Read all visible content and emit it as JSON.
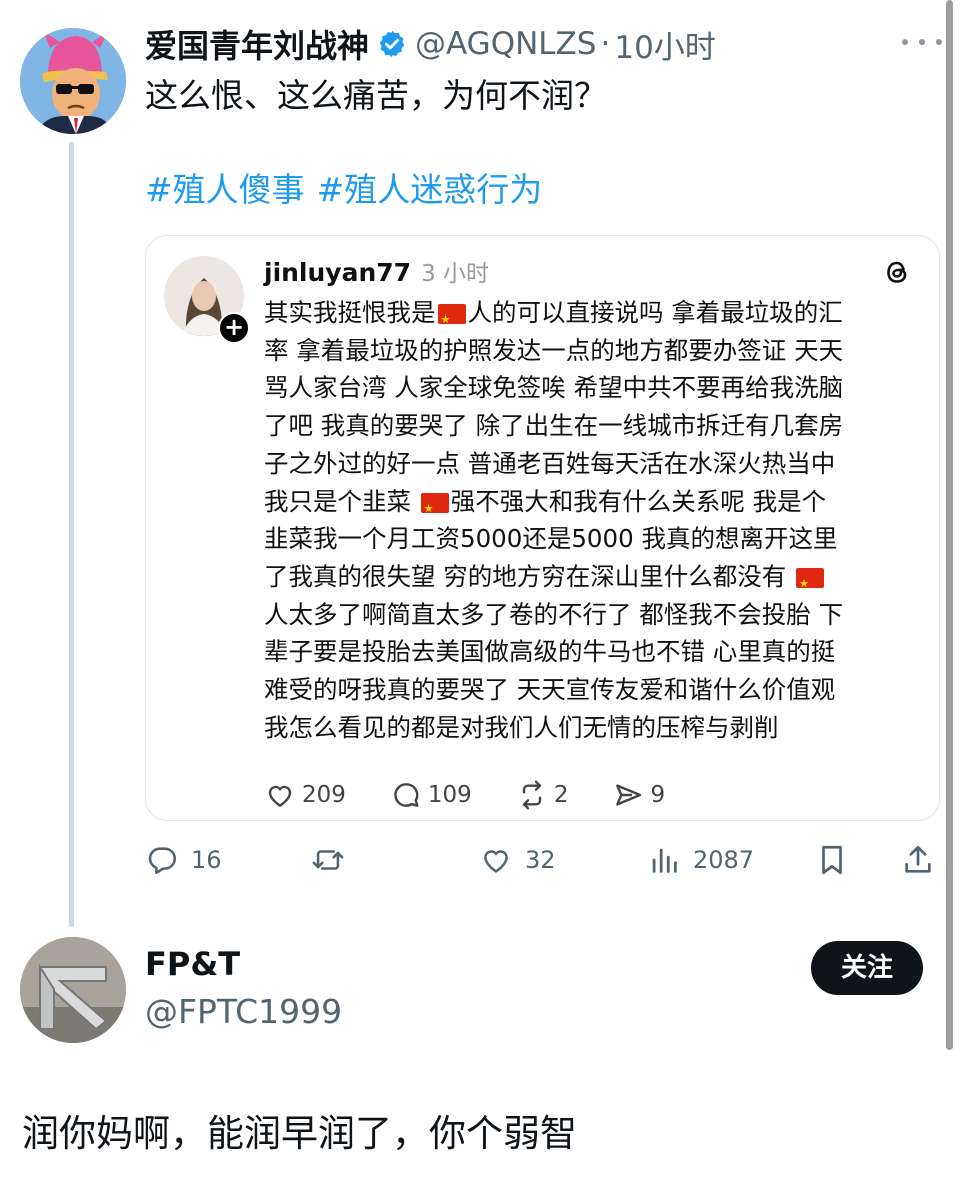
{
  "post": {
    "author_name": "爱国青年刘战神",
    "handle": "@AGQNLZS",
    "separator": "·",
    "time": "10小时",
    "text": "这么恨、这么痛苦，为何不润？",
    "hashtags": [
      "#殖人傻事",
      "#殖人迷惑行为"
    ]
  },
  "embedded": {
    "username": "jinluyan77",
    "time": "3 小时",
    "lines": [
      [
        "其实我挺恨我是",
        "[flag]",
        "人的可以直接说吗 拿着最垃圾的汇"
      ],
      [
        "率 拿着最垃圾的护照发达一点的地方都要办签证 天天"
      ],
      [
        "骂人家台湾 人家全球免签唉 希望中共不要再给我洗脑"
      ],
      [
        "了吧 我真的要哭了 除了出生在一线城市拆迁有几套房"
      ],
      [
        "子之外过的好一点 普通老百姓每天活在水深火热当中"
      ],
      [
        "我只是个韭菜 ",
        "[flag]",
        "强不强大和我有什么关系呢 我是个"
      ],
      [
        "韭菜我一个月工资5000还是5000 我真的想离开这里"
      ],
      [
        "了我真的很失望 穷的地方穷在深山里什么都没有 ",
        "[flag]"
      ],
      [
        "人太多了啊简直太多了卷的不行了 都怪我不会投胎 下"
      ],
      [
        "辈子要是投胎去美国做高级的牛马也不错 心里真的挺"
      ],
      [
        "难受的呀我真的要哭了 天天宣传友爱和谐什么价值观"
      ],
      [
        "我怎么看见的都是对我们人们无情的压榨与剥削"
      ]
    ],
    "likes": "209",
    "comments": "109",
    "reposts": "2",
    "shares": "9",
    "plus_badge": "+",
    "flag_color": "#de2910"
  },
  "actions": {
    "replies": "16",
    "retweets": "",
    "likes": "32",
    "views": "2087"
  },
  "reply": {
    "name": "FP&T",
    "handle": "@FPTC1999",
    "follow_label": "关注",
    "text": "润你妈啊，能润早润了，你个弱智"
  },
  "colors": {
    "link": "#1d9bf0",
    "muted": "#536471",
    "verified": "#1d9bf0"
  }
}
